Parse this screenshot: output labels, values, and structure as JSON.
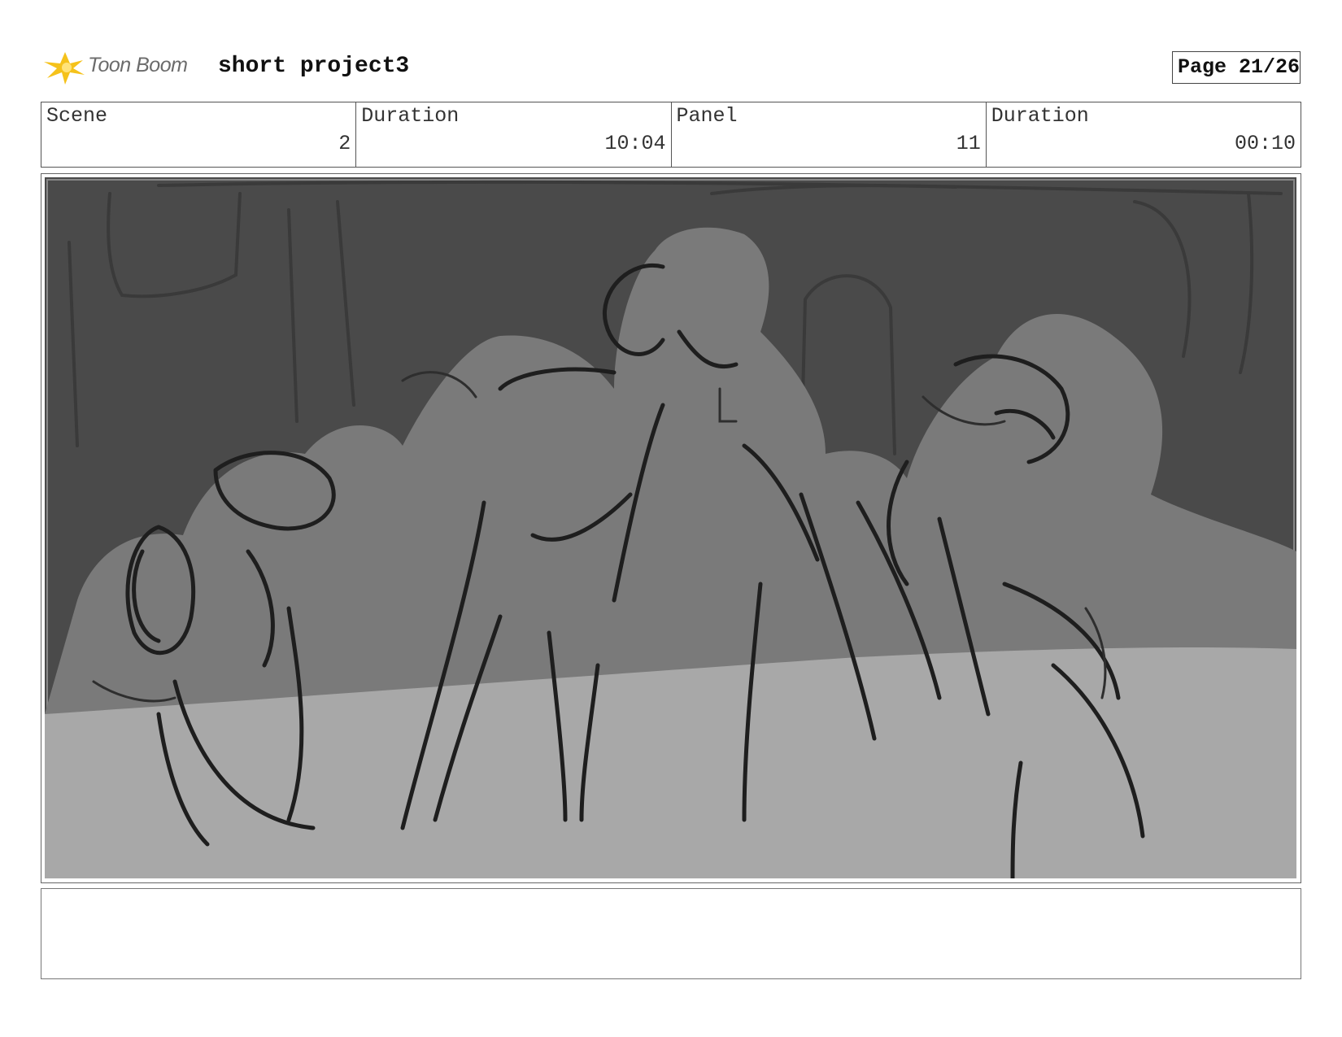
{
  "header": {
    "logo_text": "Toon Boom",
    "project_title": "short project3",
    "page_label": "Page 21/26"
  },
  "info": {
    "scene_label": "Scene",
    "scene_value": "2",
    "scene_duration_label": "Duration",
    "scene_duration_value": "10:04",
    "panel_label": "Panel",
    "panel_value": "11",
    "panel_duration_label": "Duration",
    "panel_duration_value": "00:10"
  },
  "notes": {
    "text": ""
  },
  "colors": {
    "logo_accent": "#f5c21b",
    "sketch_dark_bg": "#4a4a4a",
    "sketch_mid": "#7a7a7a",
    "sketch_light": "#a8a8a8"
  }
}
